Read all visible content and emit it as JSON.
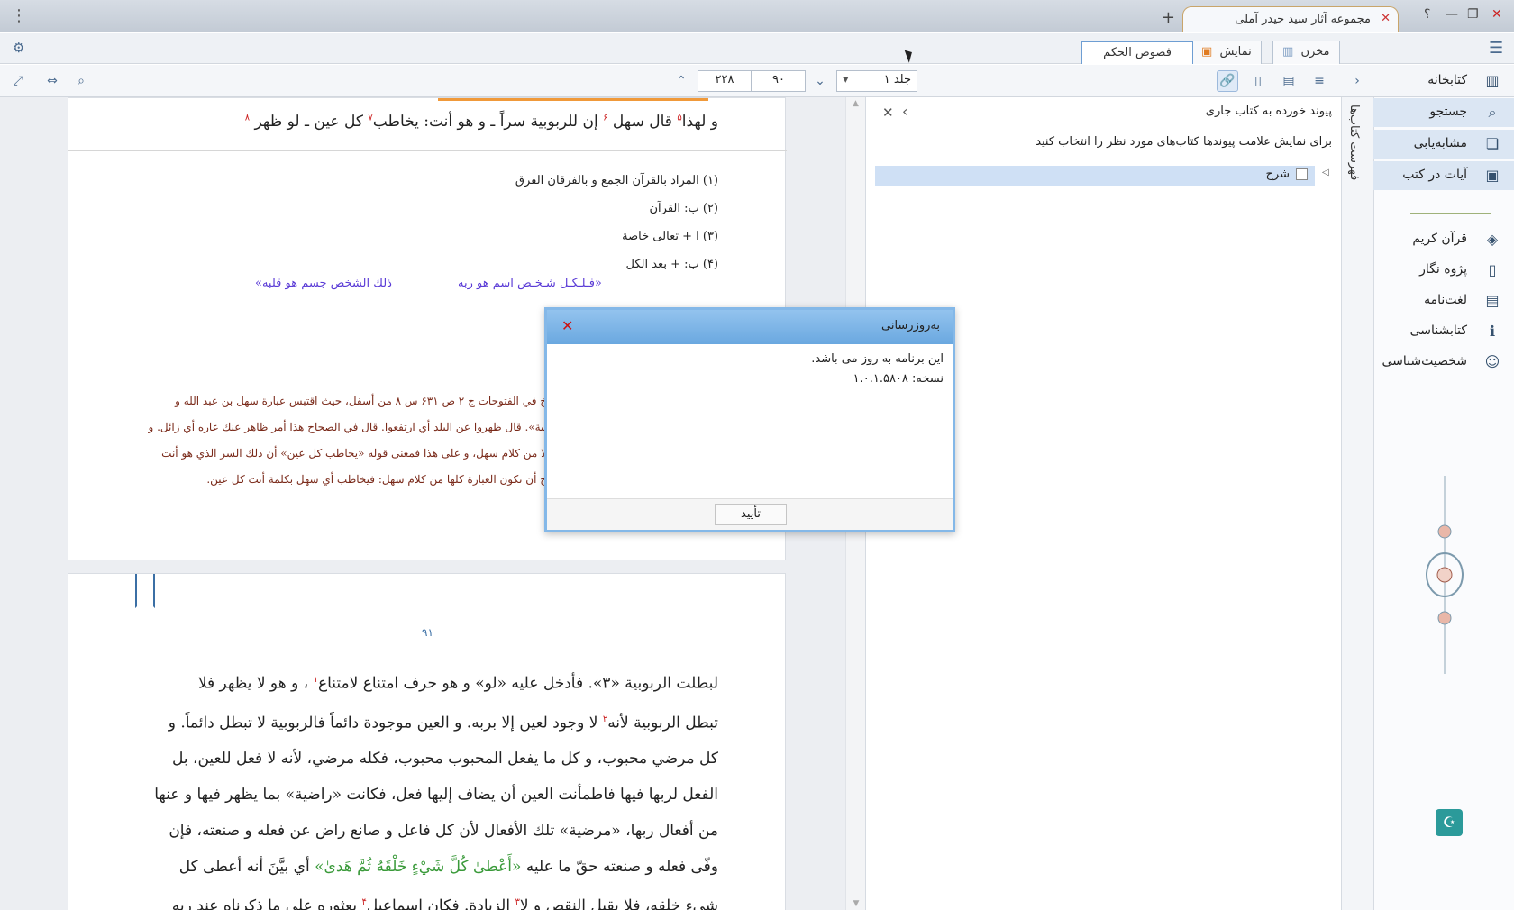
{
  "titlebar": {
    "tab_title": "مجموعه آثار سید حیدر آملی",
    "add_label": "+",
    "help_label": "؟",
    "menu_glyph": "⋮"
  },
  "toolbar1": {
    "tabs": [
      {
        "label": "مخزن"
      },
      {
        "label": "نمایش"
      },
      {
        "label": "فصوص الحکم"
      }
    ]
  },
  "toolbar2": {
    "volume_label": "جلد ۱",
    "page_current": "۹۰",
    "page_total": "۲۲۸"
  },
  "sidebar": {
    "items": [
      {
        "label": "کتابخانه",
        "icon": "library-icon"
      },
      {
        "label": "جستجو",
        "icon": "search-icon"
      },
      {
        "label": "مشابه‌یابی",
        "icon": "similar-icon"
      },
      {
        "label": "آیات در کتب",
        "icon": "verses-icon"
      },
      {
        "label": "قرآن کریم",
        "icon": "quran-icon"
      },
      {
        "label": "پژوه نگار",
        "icon": "notebook-icon"
      },
      {
        "label": "لغت‌نامه",
        "icon": "dictionary-icon"
      },
      {
        "label": "کتابشناسی",
        "icon": "bibliography-icon"
      },
      {
        "label": "شخصیت‌شناسی",
        "icon": "person-icon"
      }
    ]
  },
  "vtab": {
    "label": "فهرست کتاب‌ها"
  },
  "links": {
    "title": "پیوند خورده به کتاب جاری",
    "hint": "برای نمایش علامت پیوندها کتاب‌های مورد نظر را انتخاب کنید",
    "tree_item": "شرح"
  },
  "page1": {
    "line1_a": "و لهذا",
    "n5": "۵",
    "line1_b": " قال سهل ",
    "n6": "۶",
    "line1_c": " إن للربوبية سراً ـ و هو أنت: يخاطب",
    "n7": "۷",
    "line1_d": " كل عين ـ لو ظهر ",
    "n8": "۸",
    "footnotes": [
      "(۱)  المراد بالقرآن الجمع و بالفرقان الفرق",
      "(۲)  ب: القرآن",
      "(۳)  ا + تعالى خاصة",
      "(۴)  ب: + بعد الكل"
    ],
    "diagram_a": "«فـلـكـل شـخـص اسم هو ربه",
    "diagram_b": "ذلك الشخص جسم هو قلبه»",
    "commentary": [
      "خ في الفتوحات ج ۲ ص ۶۳۱ س ۸ من أسفل، حيث اقتبس عبارة سهل بن عبد الله و",
      "بية». قال ظهروا عن البلد أي ارتفعوا. قال في الصحاح هذا أمر ظاهر عنك عاره أي زائل. و",
      "لا من كلام سهل، و على هذا فمعنى قوله «يخاطب كل عين» أن ذلك السر الذي هو أنت",
      "ح أن تكون العبارة كلها من كلام سهل: فيخاطب أي سهل بكلمة أنت كل عين."
    ]
  },
  "page2": {
    "page_number": "۹۱",
    "l1a": "لبطلت الربوبية «۳». فأدخل عليه «لو» و هو حرف امتناع لامتناع",
    "l1n": "۱",
    "l1b": " ، و هو لا يظهر فلا",
    "l2a": "تبطل الربوبية لأنه",
    "l2n": "۲",
    "l2b": " لا وجود لعين إلا بربه. و العين موجودة دائماً فالربوبية لا تبطل دائماً. و",
    "l3": "كل مرضي محبوب، و كل ما يفعل المحبوب محبوب، فكله مرضي، لأنه لا فعل للعين، بل",
    "l4": "الفعل لربها فيها فاطمأنت العين أن يضاف إليها فعل، فكانت «راضية» بما يظهر فيها و عنها",
    "l5": "من أفعال ربها، «مرضية» تلك الأفعال لأن كل فاعل و صانع راض عن فعله و صنعته، فإن",
    "l6a": "وفّى فعله و صنعته حقّ ما عليه ",
    "l6g": "«أَعْطىٰ كُلَّ شَيْءٍ خَلْقَهُ ثُمَّ هَدىٰ»",
    "l6b": " أي بيَّنَ أنه أعطى كل",
    "l7a": "شيء خلقه، فلا يقبل النقص و لا",
    "l7n": "۳",
    "l7b": " الزيادة. فكان إسماعيل",
    "l7n2": "۴",
    "l7c": " بعثوره على ما ذكرناه عند ربه"
  },
  "dialog": {
    "title": "به‌روزرسانی",
    "message": "این برنامه به روز می باشد.",
    "version": "نسخه: ۱.۰.۱.۵۸۰۸",
    "ok_label": "تأیید"
  }
}
